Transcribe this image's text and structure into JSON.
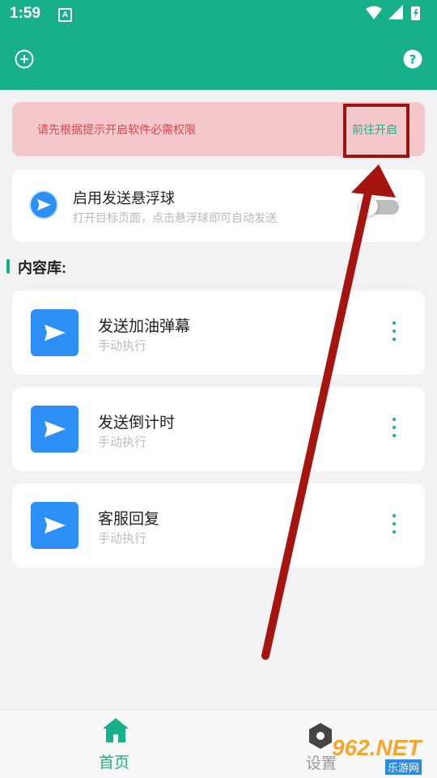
{
  "status_bar": {
    "time": "1:59",
    "notification_icon": "A"
  },
  "header": {
    "left_icon": "plus-circle-icon",
    "right_icon": "help-circle-icon",
    "color": "#17b08a"
  },
  "banner": {
    "message": "请先根据提示开启软件必需权限",
    "action_label": "前往开启"
  },
  "floating_card": {
    "title": "启用发送悬浮球",
    "subtitle": "打开目标页面，点击悬浮球即可自动发送",
    "toggle_on": false
  },
  "library": {
    "title": "内容库:",
    "items": [
      {
        "title": "发送加油弹幕",
        "subtitle": "手动执行"
      },
      {
        "title": "发送倒计时",
        "subtitle": "手动执行"
      },
      {
        "title": "客服回复",
        "subtitle": "手动执行"
      }
    ]
  },
  "tabbar": {
    "tabs": [
      {
        "label": "首页",
        "icon": "home-icon",
        "active": true
      },
      {
        "label": "设置",
        "icon": "settings-icon",
        "active": false
      }
    ]
  },
  "watermark": {
    "text": "962.NET",
    "subtext": "乐游网"
  },
  "colors": {
    "accent": "#17b08a",
    "banner_bg": "#f5c8cc",
    "banner_text": "#e0454e",
    "item_icon_bg": "#2b8ff5",
    "annotation": "#9c1410"
  }
}
